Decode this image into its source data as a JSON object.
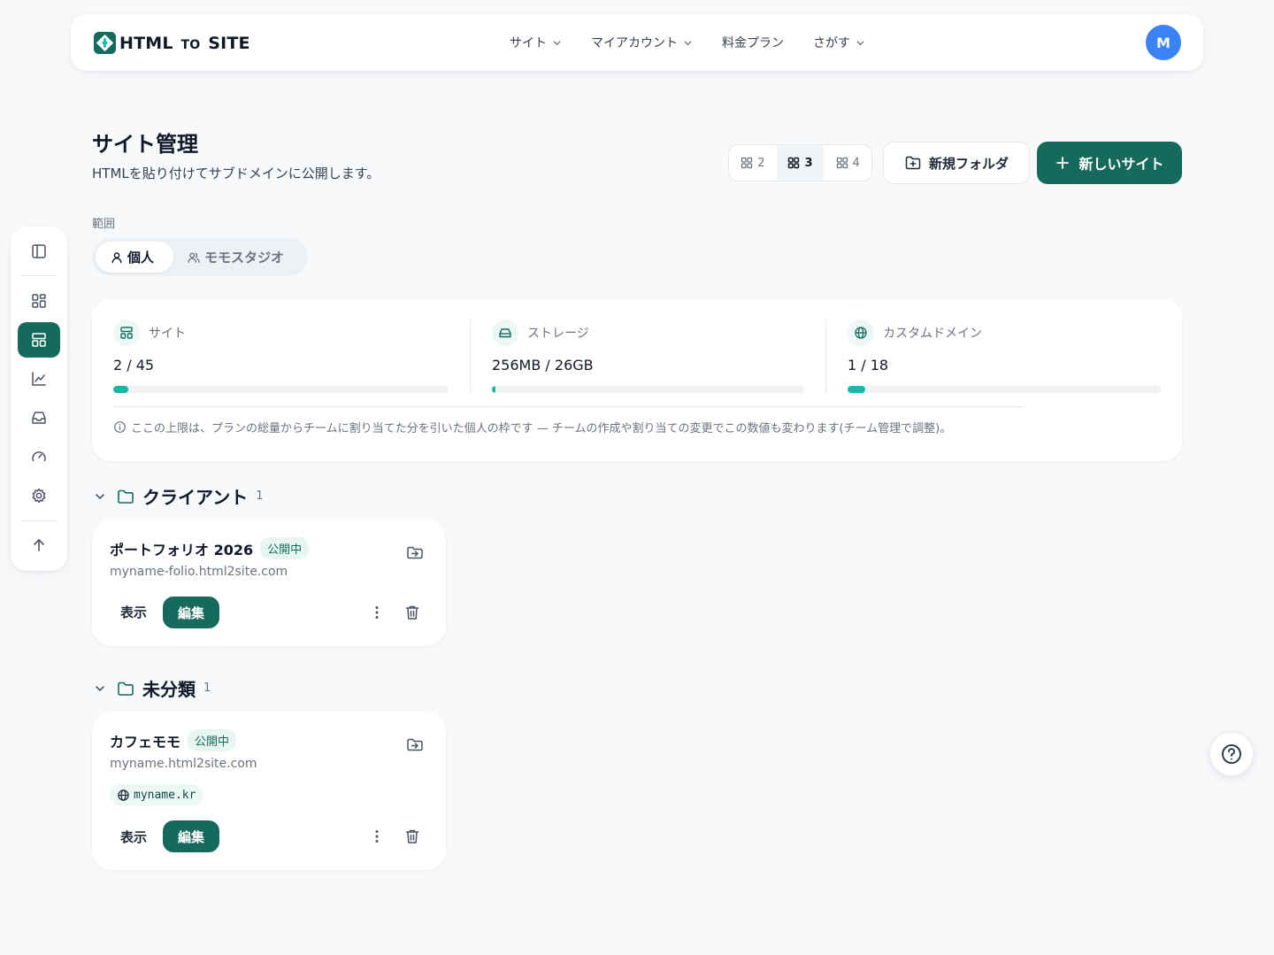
{
  "brand": {
    "name_main": "HTML",
    "name_small": "TO",
    "name_end": "SITE"
  },
  "nav": {
    "items": [
      {
        "label": "サイト",
        "has_menu": true
      },
      {
        "label": "マイアカウント",
        "has_menu": true
      },
      {
        "label": "料金プラン",
        "has_menu": false
      },
      {
        "label": "さがす",
        "has_menu": true
      }
    ],
    "avatar_initial": "M"
  },
  "rail": {
    "items": [
      "sidebar-toggle-icon",
      "dashboard-icon",
      "sites-icon",
      "analytics-icon",
      "inbox-icon",
      "speed-icon",
      "settings-icon",
      "scroll-top-icon"
    ],
    "active": "sites-icon"
  },
  "header": {
    "title": "サイト管理",
    "subtitle": "HTMLを貼り付けてサブドメインに公開します。"
  },
  "grid_columns": {
    "options": [
      "2",
      "3",
      "4"
    ],
    "selected": "3"
  },
  "actions": {
    "new_folder": "新規フォルダ",
    "new_site": "新しいサイト"
  },
  "scope": {
    "label": "範囲",
    "options": [
      "個人",
      "モモスタジオ"
    ],
    "selected": "個人"
  },
  "usage": {
    "metrics": [
      {
        "label": "サイト",
        "value": "2 / 45",
        "fraction": 0.044,
        "icon": "layout-icon"
      },
      {
        "label": "ストレージ",
        "value": "256MB / 26GB",
        "fraction": 0.01,
        "icon": "hard-drive-icon"
      },
      {
        "label": "カスタムドメイン",
        "value": "1 / 18",
        "fraction": 0.056,
        "icon": "globe-icon"
      }
    ],
    "note": "ここの上限は、プランの総量からチームに割り当てた分を引いた個人の枠です — チームの作成や割り当ての変更でこの数値も変わります(チーム管理で調整)。"
  },
  "folders": [
    {
      "name": "クライアント",
      "count": "1",
      "sites": [
        {
          "title": "ポートフォリオ 2026",
          "status": "公開中",
          "url": "myname-folio.html2site.com",
          "custom_domain": ""
        }
      ]
    },
    {
      "name": "未分類",
      "count": "1",
      "sites": [
        {
          "title": "カフェモモ",
          "status": "公開中",
          "url": "myname.html2site.com",
          "custom_domain": "myname.kr"
        }
      ]
    }
  ],
  "card_actions": {
    "view": "表示",
    "edit": "編集"
  },
  "colors": {
    "primary": "#156a5c",
    "accent": "#14b8a6",
    "avatar": "#3b82f6",
    "background": "#f7f9fb"
  }
}
